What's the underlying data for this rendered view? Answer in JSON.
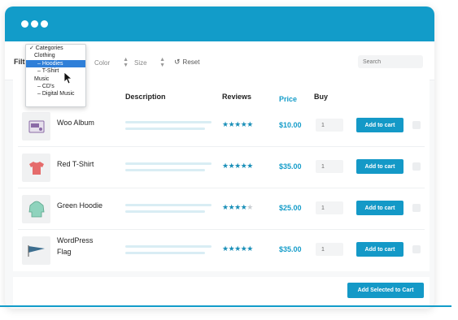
{
  "window": {
    "accent_color": "#129cc9"
  },
  "filter": {
    "label": "Filter",
    "dropdown": [
      {
        "label": "✓ Categories",
        "level": 0,
        "selected": false
      },
      {
        "label": "Clothing",
        "level": 1,
        "selected": false
      },
      {
        "label": "– Hoodies",
        "level": 2,
        "selected": true
      },
      {
        "label": "– T-Shirt",
        "level": 2,
        "selected": false
      },
      {
        "label": "Music",
        "level": 1,
        "selected": false
      },
      {
        "label": "– CD's",
        "level": 2,
        "selected": false
      },
      {
        "label": "– Digital Music",
        "level": 2,
        "selected": false
      }
    ],
    "color_select": "Color",
    "size_select": "Size",
    "reset_label": "Reset",
    "search_placeholder": "Search"
  },
  "table": {
    "headers": {
      "description": "Description",
      "reviews": "Reviews",
      "price": "Price",
      "buy": "Buy"
    },
    "rows": [
      {
        "name": "Woo Album",
        "rating": 4.5,
        "price": "$10.00",
        "qty": "1",
        "button": "Add to cart",
        "icon": "album-icon"
      },
      {
        "name": "Red T-Shirt",
        "rating": 4.5,
        "price": "$35.00",
        "qty": "1",
        "button": "Add to cart",
        "icon": "tshirt-icon"
      },
      {
        "name": "Green Hoodie",
        "rating": 4,
        "price": "$25.00",
        "qty": "1",
        "button": "Add to cart",
        "icon": "hoodie-icon"
      },
      {
        "name": "WordPress Flag",
        "name_line1": "WordPress",
        "name_line2": "Flag",
        "rating": 4.5,
        "price": "$35.00",
        "qty": "1",
        "button": "Add to cart",
        "icon": "flag-icon"
      }
    ]
  },
  "footer": {
    "add_selected_label": "Add Selected to Cart"
  }
}
